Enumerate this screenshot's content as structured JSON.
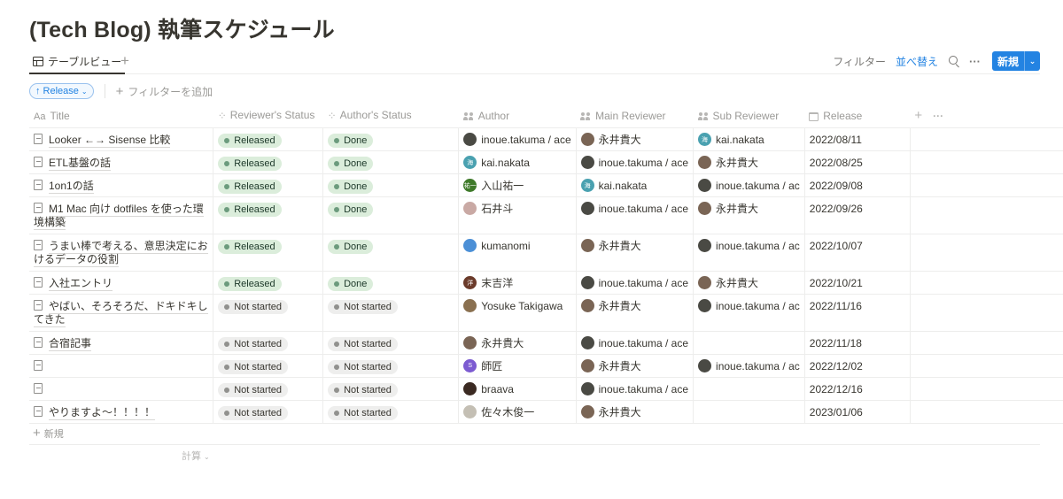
{
  "page": {
    "title": "(Tech Blog) 執筆スケジュール"
  },
  "views": {
    "active_tab": {
      "label": "テーブルビュー",
      "icon": "table-icon"
    },
    "add_view_icon": "+"
  },
  "toolbar": {
    "filter_label": "フィルター",
    "sort_label": "並べ替え",
    "search_icon": "search-icon",
    "more_icon": "···",
    "new_label": "新規",
    "new_dropdown_icon": "⌵"
  },
  "filterbar": {
    "sort_chip_label": "↑ Release",
    "sort_chip_chevron": "⌵",
    "add_filter_plus": "+",
    "add_filter_label": "フィルターを追加"
  },
  "columns": [
    {
      "key": "title",
      "label": "Title",
      "icon": "Aa"
    },
    {
      "key": "reviewer_status",
      "label": "Reviewer's Status",
      "icon": "status-icon"
    },
    {
      "key": "author_status",
      "label": "Author's Status",
      "icon": "status-icon"
    },
    {
      "key": "author",
      "label": "Author",
      "icon": "people-icon"
    },
    {
      "key": "main_reviewer",
      "label": "Main Reviewer",
      "icon": "people-icon"
    },
    {
      "key": "sub_reviewer",
      "label": "Sub Reviewer",
      "icon": "people-icon"
    },
    {
      "key": "release",
      "label": "Release",
      "icon": "calendar-icon"
    }
  ],
  "header_actions": {
    "add": "+",
    "more": "···"
  },
  "status_colors": {
    "Released": "#dbeddb",
    "Done": "#dbeddb",
    "Not started": "#eeeeed"
  },
  "people": {
    "inoue.takuma / ace": {
      "color": "#4a4a44",
      "initial": ""
    },
    "永井貴大": {
      "color": "#7a6555",
      "initial": ""
    },
    "kai.nakata": {
      "color": "#4aa1b0",
      "initial": "海"
    },
    "入山祐一": {
      "color": "#3f7a2a",
      "initial": "祐一"
    },
    "石井斗": {
      "color": "#c9a9a4",
      "initial": ""
    },
    "kumanomi": {
      "color": "#4b8fd6",
      "initial": ""
    },
    "末吉洋": {
      "color": "#6b3b2b",
      "initial": "洋"
    },
    "Yosuke Takigawa": {
      "color": "#8a7050",
      "initial": ""
    },
    "師匠": {
      "color": "#7c5bd1",
      "initial": "S"
    },
    "braava": {
      "color": "#3b2a22",
      "initial": ""
    },
    "佐々木俊一": {
      "color": "#c4bfb4",
      "initial": ""
    }
  },
  "rows": [
    {
      "title": "Looker ←→ Sisense 比較",
      "reviewer_status": "Released",
      "author_status": "Done",
      "author": "inoue.takuma / ace",
      "main_reviewer": "永井貴大",
      "sub_reviewer": "kai.nakata",
      "release": "2022/08/11",
      "lines": 1
    },
    {
      "title": "ETL基盤の話",
      "reviewer_status": "Released",
      "author_status": "Done",
      "author": "kai.nakata",
      "main_reviewer": "inoue.takuma / ace",
      "sub_reviewer": "永井貴大",
      "release": "2022/08/25",
      "lines": 1
    },
    {
      "title": "1on1の話",
      "reviewer_status": "Released",
      "author_status": "Done",
      "author": "入山祐一",
      "main_reviewer": "kai.nakata",
      "sub_reviewer": "inoue.takuma / ac",
      "release": "2022/09/08",
      "lines": 1
    },
    {
      "title": "M1 Mac 向け dotfiles を使った環境構築",
      "reviewer_status": "Released",
      "author_status": "Done",
      "author": "石井斗",
      "main_reviewer": "inoue.takuma / ace",
      "sub_reviewer": "永井貴大",
      "release": "2022/09/26",
      "lines": 2
    },
    {
      "title": "うまい棒で考える、意思決定におけるデータの役割",
      "reviewer_status": "Released",
      "author_status": "Done",
      "author": "kumanomi",
      "main_reviewer": "永井貴大",
      "sub_reviewer": "inoue.takuma / ac",
      "release": "2022/10/07",
      "lines": 2
    },
    {
      "title": "入社エントリ",
      "reviewer_status": "Released",
      "author_status": "Done",
      "author": "末吉洋",
      "main_reviewer": "inoue.takuma / ace",
      "sub_reviewer": "永井貴大",
      "release": "2022/10/21",
      "lines": 1
    },
    {
      "title": "やばい、そろそろだ、ドキドキしてきた",
      "reviewer_status": "Not started",
      "author_status": "Not started",
      "author": "Yosuke Takigawa",
      "main_reviewer": "永井貴大",
      "sub_reviewer": "inoue.takuma / ac",
      "release": "2022/11/16",
      "lines": 2
    },
    {
      "title": "合宿記事",
      "reviewer_status": "Not started",
      "author_status": "Not started",
      "author": "永井貴大",
      "main_reviewer": "inoue.takuma / ace",
      "sub_reviewer": "",
      "release": "2022/11/18",
      "lines": 1
    },
    {
      "title": "",
      "reviewer_status": "Not started",
      "author_status": "Not started",
      "author": "師匠",
      "main_reviewer": "永井貴大",
      "sub_reviewer": "inoue.takuma / ac",
      "release": "2022/12/02",
      "lines": 1
    },
    {
      "title": "",
      "reviewer_status": "Not started",
      "author_status": "Not started",
      "author": "braava",
      "main_reviewer": "inoue.takuma / ace",
      "sub_reviewer": "",
      "release": "2022/12/16",
      "lines": 1
    },
    {
      "title": "やりますよ〜！！！！",
      "reviewer_status": "Not started",
      "author_status": "Not started",
      "author": "佐々木俊一",
      "main_reviewer": "永井貴大",
      "sub_reviewer": "",
      "release": "2023/01/06",
      "lines": 1
    }
  ],
  "footer": {
    "add_row_plus": "+",
    "add_row_label": "新規",
    "calc_label": "計算",
    "calc_chevron": "⌵"
  }
}
